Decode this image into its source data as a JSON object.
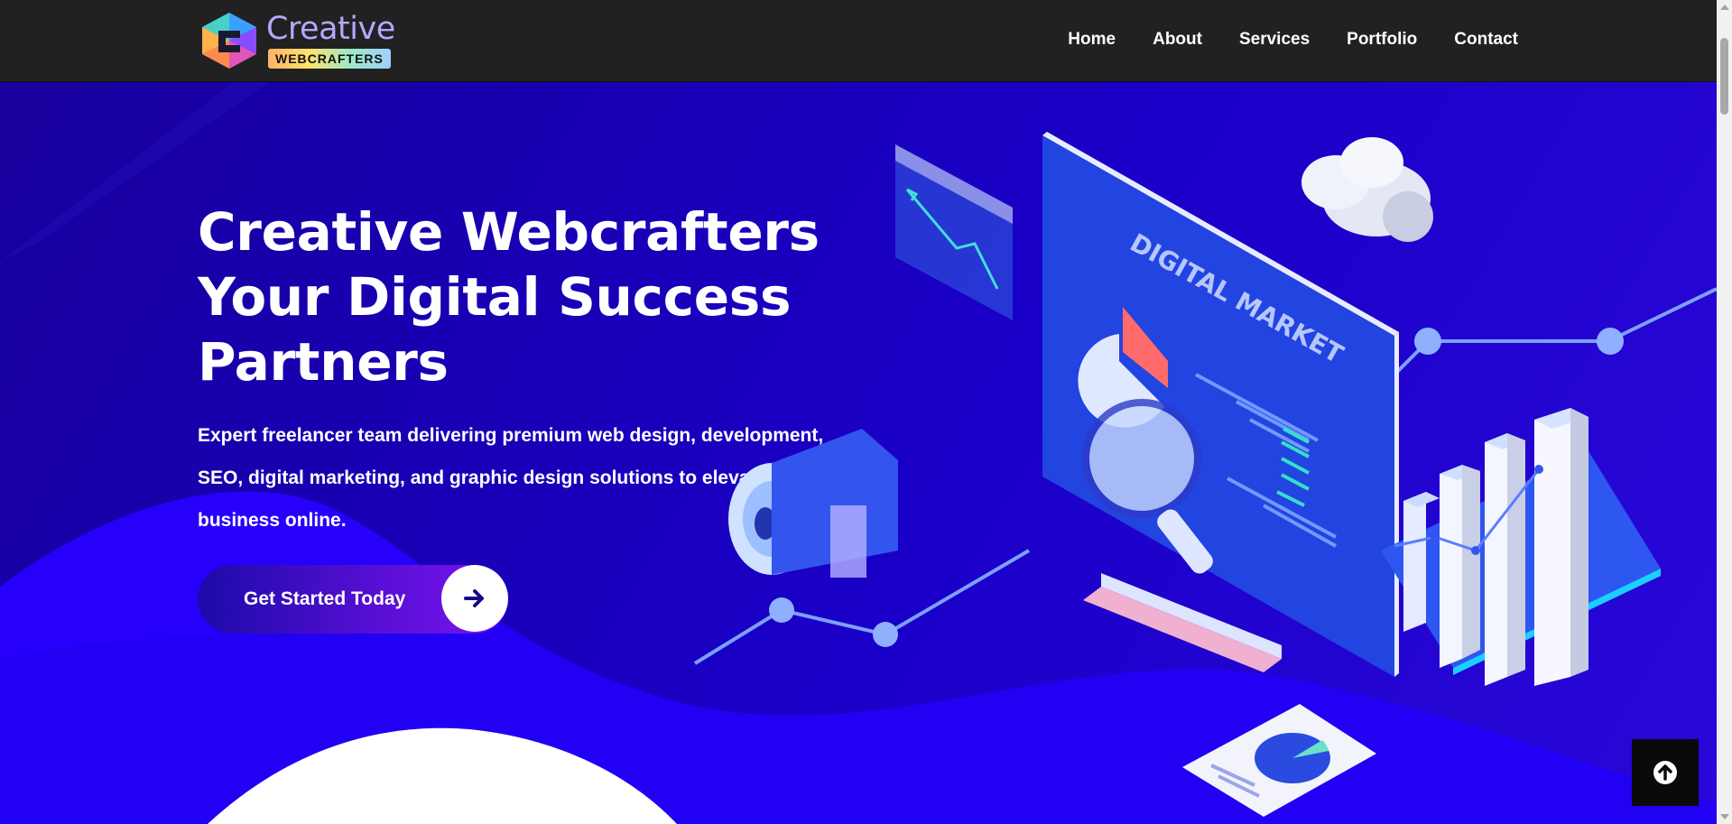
{
  "brand": {
    "name_line1": "Creative",
    "name_line2": "WEBCRAFTERS"
  },
  "nav": {
    "items": [
      {
        "label": "Home"
      },
      {
        "label": "About"
      },
      {
        "label": "Services"
      },
      {
        "label": "Portfolio"
      },
      {
        "label": "Contact"
      }
    ]
  },
  "hero": {
    "title_lines": [
      "Creative Webcrafters",
      "Your Digital Success",
      "Partners"
    ],
    "subtitle": "Expert freelancer team delivering premium web design, development, SEO, digital marketing, and graphic design solutions to elevate your business online.",
    "cta_label": "Get Started Today",
    "illustration_label": "DIGITAL MARKET"
  },
  "icons": {
    "cta": "arrow-right-icon",
    "to_top": "arrow-up-circle-icon"
  },
  "colors": {
    "nav_bg": "#212121",
    "hero_bg": "#1a00d6",
    "accent": "#7a14f0",
    "text": "#ffffff"
  }
}
